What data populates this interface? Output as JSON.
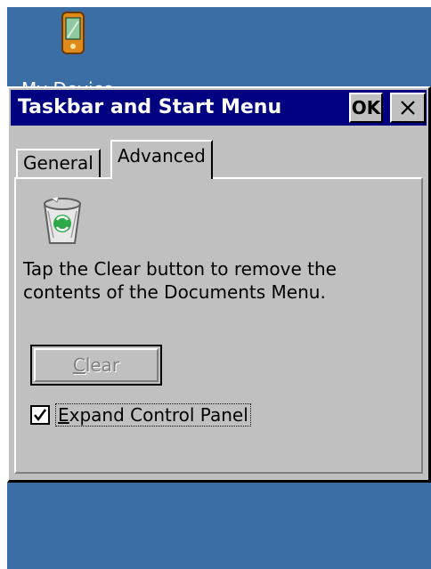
{
  "desktop": {
    "icon_label": "My Device",
    "background_color": "#3a6ea5",
    "icon_name": "pda-device-icon"
  },
  "window": {
    "title": "Taskbar and Start Menu",
    "ok_label": "OK",
    "close_label": "✕",
    "titlebar_color": "#000080",
    "face_color": "#c0c0c0"
  },
  "tabs": [
    {
      "label": "General",
      "selected": false
    },
    {
      "label": "Advanced",
      "selected": true
    }
  ],
  "advanced": {
    "icon_name": "recycle-bin-icon",
    "description": "Tap the Clear button to remove the contents of the Documents Menu.",
    "clear_button": {
      "prefix": "",
      "mnemonic": "C",
      "suffix": "lear",
      "enabled": false
    },
    "expand_checkbox": {
      "prefix": "",
      "mnemonic": "E",
      "suffix": "xpand Control Panel",
      "checked": true
    }
  }
}
